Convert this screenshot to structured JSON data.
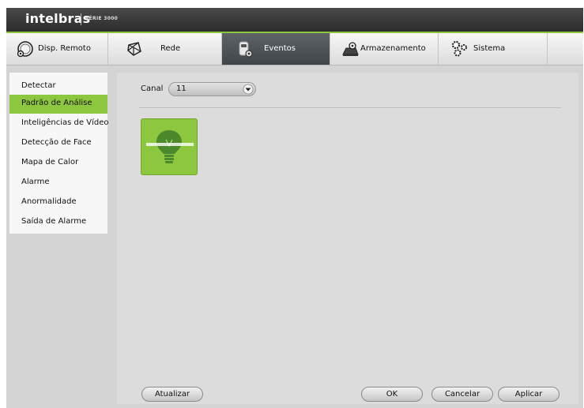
{
  "brand": {
    "name": "intelbras",
    "series": "SÉRIE 3000"
  },
  "colors": {
    "accent": "#8dc63f",
    "header": "#333333",
    "active_tab": "#4f5558",
    "panel": "#d4d4d4"
  },
  "tabs": [
    {
      "label": "Disp. Remoto",
      "icon": "remote-device-icon",
      "active": false
    },
    {
      "label": "Rede",
      "icon": "network-icon",
      "active": false
    },
    {
      "label": "Eventos",
      "icon": "events-icon",
      "active": true
    },
    {
      "label": "Armazenamento",
      "icon": "storage-icon",
      "active": false
    },
    {
      "label": "Sistema",
      "icon": "gears-icon",
      "active": false
    }
  ],
  "sidebar": {
    "items": [
      {
        "label": "Detectar"
      },
      {
        "label": "Padrão de Análise",
        "active": true
      },
      {
        "label": "Inteligências de Vídeo"
      },
      {
        "label": "Detecção de Face"
      },
      {
        "label": "Mapa de Calor"
      },
      {
        "label": "Alarme"
      },
      {
        "label": "Anormalidade"
      },
      {
        "label": "Saída de Alarme"
      }
    ]
  },
  "main": {
    "canal_label": "Canal",
    "canal_value": "11",
    "tile_icon": "lightbulb-icon"
  },
  "buttons": {
    "atualizar": "Atualizar",
    "ok": "OK",
    "cancelar": "Cancelar",
    "aplicar": "Aplicar"
  }
}
